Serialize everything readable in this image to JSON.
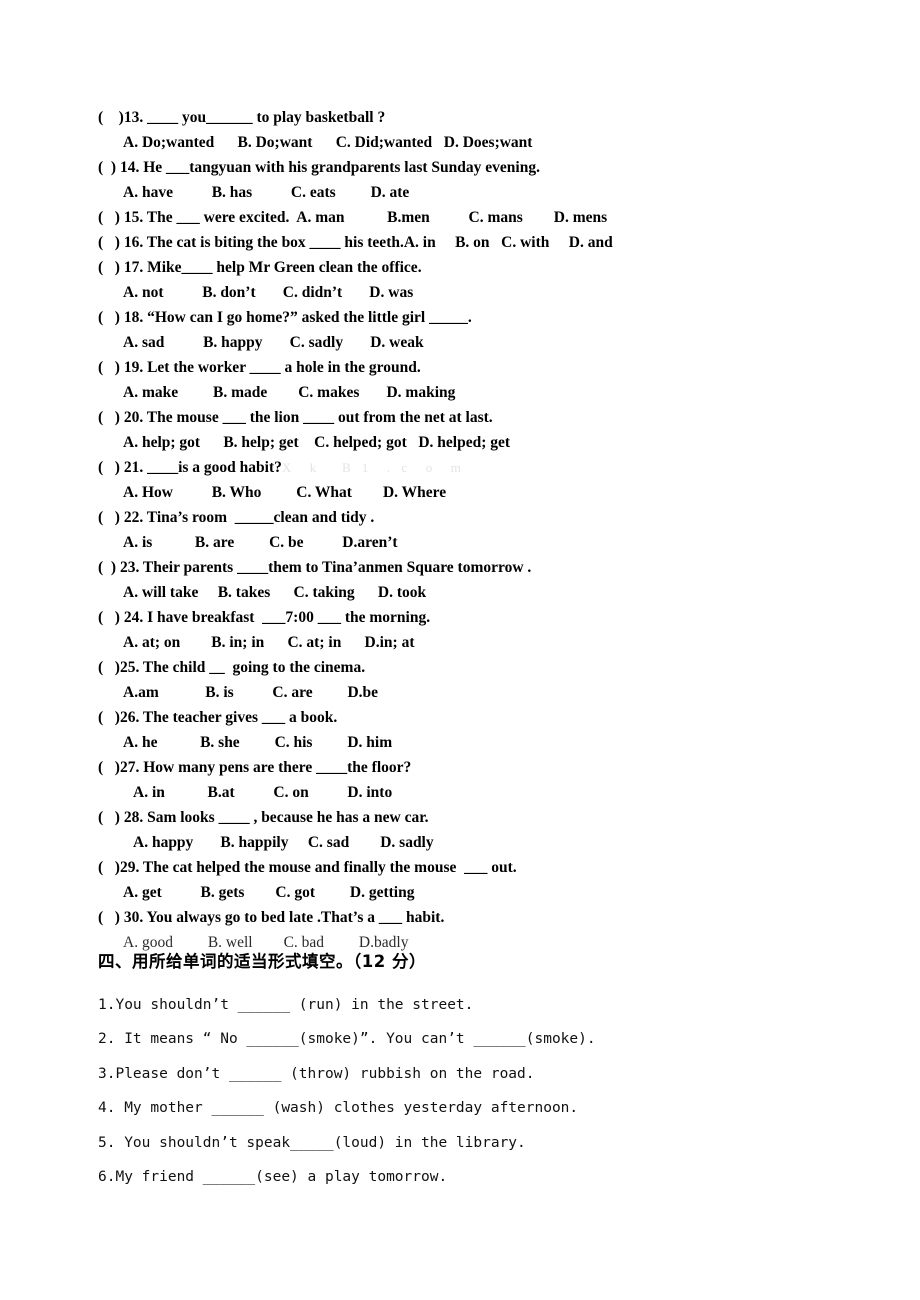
{
  "document": {
    "page_background": "#ffffff",
    "text_color": "#000000",
    "watermark": {
      "text": "X k B 1 . c o m",
      "color": "#e4e4e4"
    }
  },
  "multiple_choice": {
    "questions": [
      {
        "marker": "(    )13.",
        "stem": "(    )13. ____ you______ to play basketball ?",
        "options_line": "A. Do;wanted      B. Do;want      C. Did;wanted   D. Does;want",
        "options_style": "bold",
        "options_indent": "normal"
      },
      {
        "marker": "(  ) 14.",
        "stem": "(  ) 14. He ___tangyuan with his grandparents last Sunday evening.",
        "options_line": "A. have          B. has          C. eats         D. ate",
        "options_style": "bold",
        "options_indent": "normal"
      },
      {
        "marker": "(   ) 15.",
        "stem": "(   ) 15. The ___ were excited.  A. man           B.men          C. mans        D. mens",
        "options_line": "",
        "options_style": "bold",
        "options_indent": "normal"
      },
      {
        "marker": "(   ) 16.",
        "stem": "(   ) 16. The cat is biting the box ____ his teeth.A. in     B. on   C. with     D. and",
        "options_line": "",
        "options_style": "bold",
        "options_indent": "normal"
      },
      {
        "marker": "(   ) 17.",
        "stem": "(   ) 17. Mike____ help Mr Green clean the office.",
        "options_line": "A. not          B. don’t       C. didn’t       D. was",
        "options_style": "bold",
        "options_indent": "normal"
      },
      {
        "marker": "(   ) 18.",
        "stem": "(   ) 18. “How can I go home?” asked the little girl _____.",
        "options_line": "A. sad          B. happy       C. sadly       D. weak",
        "options_style": "bold",
        "options_indent": "normal"
      },
      {
        "marker": "(   ) 19.",
        "stem": "(   ) 19. Let the worker ____ a hole in the ground.",
        "options_line": "A. make         B. made        C. makes       D. making",
        "options_style": "bold",
        "options_indent": "normal"
      },
      {
        "marker": "(   ) 20.",
        "stem": "(   ) 20. The mouse ___ the lion ____ out from the net at last.",
        "options_line": "A. help; got      B. help; get    C. helped; got   D. helped; get",
        "options_style": "bold",
        "options_indent": "normal"
      },
      {
        "marker": "(   ) 21.",
        "stem": "(   ) 21. ____is a good habit?",
        "stem_watermark": "X  k   B 1  . c  o  m",
        "options_line": "A. How          B. Who         C. What        D. Where",
        "options_style": "bold",
        "options_indent": "normal"
      },
      {
        "marker": "(   ) 22.",
        "stem": "(   ) 22. Tina’s room  _____clean and tidy .",
        "options_line": "A. is           B. are         C. be          D.aren’t",
        "options_style": "bold",
        "options_indent": "normal"
      },
      {
        "marker": "(  ) 23.",
        "stem": "(  ) 23. Their parents ____them to Tina’anmen Square tomorrow .",
        "options_line": "A. will take     B. takes      C. taking      D. took",
        "options_style": "bold",
        "options_indent": "normal"
      },
      {
        "marker": "(   ) 24.",
        "stem": "(   ) 24. I have breakfast  ___7:00 ___ the morning.",
        "options_line": "A. at; on        B. in; in      C. at; in      D.in; at",
        "options_style": "bold",
        "options_indent": "normal"
      },
      {
        "marker": "(   )25.",
        "stem": "(   )25. The child __  going to the cinema.",
        "options_line": "A.am            B. is          C. are         D.be",
        "options_style": "bold",
        "options_indent": "normal"
      },
      {
        "marker": "(   )26.",
        "stem": "(   )26. The teacher gives ___ a book.",
        "options_line": "A. he           B. she         C. his         D. him",
        "options_style": "bold",
        "options_indent": "normal"
      },
      {
        "marker": "(   )27.",
        "stem": "(   )27. How many pens are there ____the floor?",
        "options_line": "A. in           B.at          C. on          D. into",
        "options_style": "bold",
        "options_indent": "deep"
      },
      {
        "marker": "(   ) 28.",
        "stem": "(   ) 28. Sam looks ____ , because he has a new car.",
        "options_line": "A. happy       B. happily     C. sad        D. sadly",
        "options_style": "bold",
        "options_indent": "deep"
      },
      {
        "marker": "(   )29.",
        "stem": "(   )29. The cat helped the mouse and finally the mouse  ___ out.",
        "options_line": "A. get          B. gets        C. got         D. getting",
        "options_style": "bold",
        "options_indent": "normal"
      },
      {
        "marker": "(   ) 30.",
        "stem": "(   ) 30. You always go to bed late .That’s a ___ habit.",
        "options_line": "A. good         B. well        C. bad         D.badly",
        "options_style": "light",
        "options_indent": "normal"
      }
    ]
  },
  "section_four": {
    "heading": "四、用所给单词的适当形式填空。（12 分）",
    "items": [
      "1.You shouldn’t ______ (run) in the street.",
      "2. It means “ No ______(smoke)”. You can’t ______(smoke).",
      "3.Please don’t ______ (throw) rubbish on the road.",
      "4. My mother ______ (wash) clothes yesterday afternoon.",
      "5. You shouldn’t speak_____(loud) in the library.",
      "6.My friend ______(see) a play tomorrow."
    ]
  }
}
